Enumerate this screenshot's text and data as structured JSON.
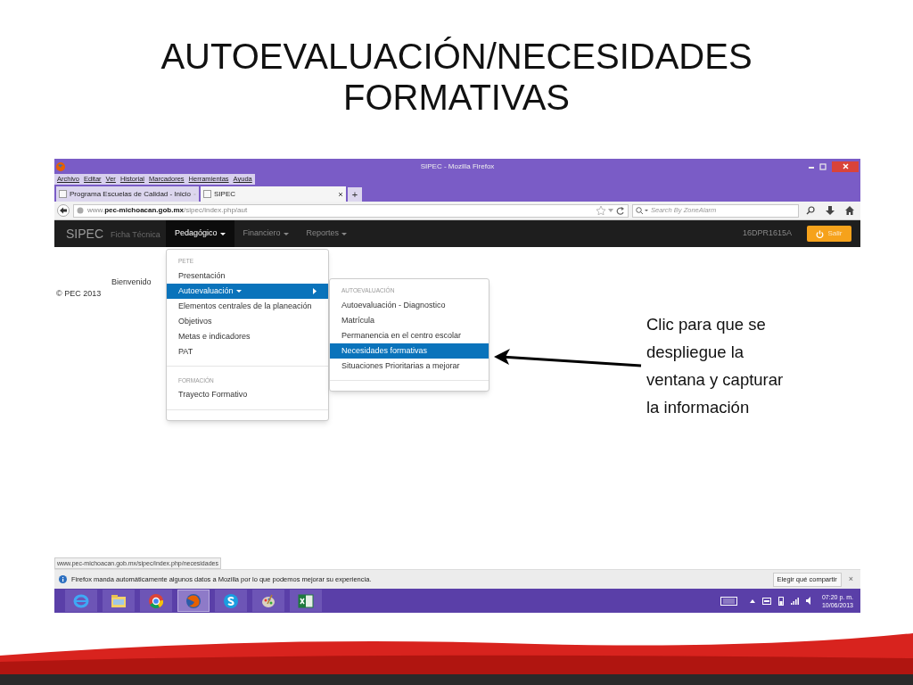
{
  "slide": {
    "title_lines": [
      "AUTOEVALUACIÓN/NECESIDADES",
      "FORMATIVAS"
    ],
    "callout": "Clic para que se despliegue la ventana y capturar la información"
  },
  "browser": {
    "window_title": "SIPEC - Mozilla Firefox",
    "menu": [
      "Archivo",
      "Editar",
      "Ver",
      "Historial",
      "Marcadores",
      "Herramientas",
      "Ayuda"
    ],
    "tabs": [
      {
        "label": "Programa Escuelas de Calidad - Inicio",
        "selected": false
      },
      {
        "label": "SIPEC",
        "selected": true
      }
    ],
    "new_tab": "+",
    "url": {
      "prefix": "www.",
      "domain": "pec-michoacan.gob.mx",
      "path": "/sipec/index.php/aut"
    },
    "search": {
      "placeholder": "Search By ZoneAlarm"
    }
  },
  "app": {
    "brand": "SIPEC",
    "ghost_text": "Ficha Técnica",
    "nav": [
      {
        "label": "Pedagógico",
        "selected": true
      },
      {
        "label": "Financiero",
        "selected": false
      },
      {
        "label": "Reportes",
        "selected": false
      }
    ],
    "user": "16DPR1615A",
    "logout": "Salir",
    "welcome": "Bienvenido",
    "footer": "© PEC 2013"
  },
  "dropdown": [
    {
      "kind": "header",
      "label": "PETE"
    },
    {
      "kind": "item",
      "label": "Presentación",
      "selected": false,
      "has_submenu": false
    },
    {
      "kind": "item",
      "label": "Autoevaluación",
      "selected": true,
      "has_submenu": true
    },
    {
      "kind": "item",
      "label": "Elementos centrales de la planeación",
      "selected": false,
      "has_submenu": false
    },
    {
      "kind": "item",
      "label": "Objetivos",
      "selected": false,
      "has_submenu": false
    },
    {
      "kind": "item",
      "label": "Metas e indicadores",
      "selected": false,
      "has_submenu": false
    },
    {
      "kind": "item",
      "label": "PAT",
      "selected": false,
      "has_submenu": false
    },
    {
      "kind": "divider"
    },
    {
      "kind": "header",
      "label": "FORMACIÓN"
    },
    {
      "kind": "item",
      "label": "Trayecto Formativo",
      "selected": false,
      "has_submenu": false
    },
    {
      "kind": "divider"
    }
  ],
  "submenu": [
    {
      "kind": "header",
      "label": "AUTOEVALUACIÓN"
    },
    {
      "kind": "item",
      "label": "Autoevaluación - Diagnostico",
      "selected": false
    },
    {
      "kind": "item",
      "label": "Matrícula",
      "selected": false
    },
    {
      "kind": "item",
      "label": "Permanencia en el centro escolar",
      "selected": false
    },
    {
      "kind": "item",
      "label": "Necesidades formativas",
      "selected": true
    },
    {
      "kind": "item",
      "label": "Situaciones Prioritarias a mejorar",
      "selected": false
    },
    {
      "kind": "divider"
    }
  ],
  "status_url": "www.pec-michoacan.gob.mx/sipec/index.php/necesidades",
  "notification": {
    "text": "Firefox manda automáticamente algunos datos a Mozilla por lo que podemos mejorar su experiencia.",
    "button": "Elegir qué compartir",
    "close": "×"
  },
  "taskbar": {
    "apps": [
      {
        "kind": "ie",
        "selected": false
      },
      {
        "kind": "folder",
        "selected": false
      },
      {
        "kind": "chrome",
        "selected": false
      },
      {
        "kind": "firefox",
        "selected": true
      },
      {
        "kind": "skype",
        "selected": false
      },
      {
        "kind": "paint",
        "selected": false
      },
      {
        "kind": "excel",
        "selected": false
      }
    ],
    "time": "07:20 p. m.",
    "date": "10/06/2013"
  }
}
